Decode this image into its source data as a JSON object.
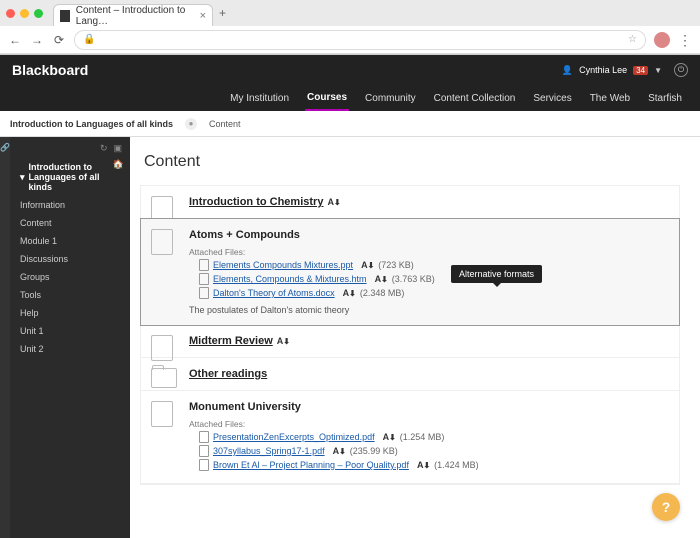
{
  "browser": {
    "tab_title": "Content – Introduction to Lang…",
    "close_glyph": "×",
    "plus_glyph": "+",
    "toolbar": {
      "back": "←",
      "forward": "→",
      "reload": "⟳",
      "lock": "🔒",
      "star": "☆",
      "kebab": "⋮"
    }
  },
  "header": {
    "brand": "Blackboard",
    "user": {
      "avatar_glyph": "👤",
      "name": "Cynthia Lee",
      "badge": "34",
      "chev": "▼"
    },
    "power_glyph": "⏻",
    "nav": [
      {
        "label": "My Institution",
        "active": false
      },
      {
        "label": "Courses",
        "active": true
      },
      {
        "label": "Community",
        "active": false
      },
      {
        "label": "Content Collection",
        "active": false
      },
      {
        "label": "Services",
        "active": false
      },
      {
        "label": "The Web",
        "active": false
      },
      {
        "label": "Starfish",
        "active": false
      }
    ]
  },
  "crumbs": {
    "course": "Introduction to Languages of all kinds",
    "section": "Content"
  },
  "sidebar": {
    "tools": {
      "refresh": "↻",
      "display": "▣"
    },
    "home_glyph": "🏠",
    "items": [
      {
        "label": "Introduction to Languages of all kinds",
        "current": true,
        "caret": "▾"
      },
      {
        "label": "Information"
      },
      {
        "label": "Content"
      },
      {
        "label": "Module 1"
      },
      {
        "label": "Discussions"
      },
      {
        "label": "Groups"
      },
      {
        "label": "Tools"
      },
      {
        "label": "Help"
      },
      {
        "label": "Unit 1"
      },
      {
        "label": "Unit 2"
      }
    ]
  },
  "page": {
    "title": "Content",
    "tooltip": "Alternative formats",
    "a_glyph": "A",
    "dl_glyph": "⬇",
    "items": [
      {
        "type": "file",
        "title": "Introduction to Chemistry",
        "link": true
      },
      {
        "type": "file",
        "title": "Atoms + Compounds",
        "highlight": true,
        "attached_label": "Attached Files:",
        "files": [
          {
            "name": "Elements Compounds Mixtures.ppt",
            "size": "(723 KB)",
            "tooltip": true
          },
          {
            "name": "Elements, Compounds & Mixtures.htm",
            "size": "(3.763 KB)"
          },
          {
            "name": "Dalton's Theory of Atoms.docx",
            "size": "(2.348 MB)"
          }
        ],
        "description": "The postulates of Dalton's atomic theory"
      },
      {
        "type": "file",
        "title": "Midterm Review",
        "link": true
      },
      {
        "type": "folder",
        "title": "Other readings",
        "link": true
      },
      {
        "type": "file",
        "title": "Monument University",
        "attached_label": "Attached Files:",
        "files": [
          {
            "name": "PresentationZenExcerpts_Optimized.pdf",
            "size": "(1.254 MB)"
          },
          {
            "name": "307syllabus_Spring17-1.pdf",
            "size": "(235.99 KB)"
          },
          {
            "name": "Brown Et Al – Project Planning – Poor Quality.pdf",
            "size": "(1.424 MB)"
          }
        ]
      }
    ]
  },
  "help_glyph": "?"
}
